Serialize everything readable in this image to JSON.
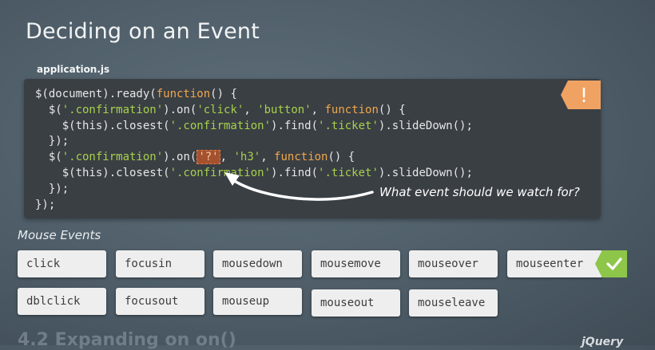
{
  "slide": {
    "title": "Deciding on an Event",
    "filename": "application.js",
    "alert_symbol": "!",
    "annotation": "What event should we watch for?"
  },
  "code": {
    "l1": {
      "a": "$(document).ready(",
      "b": "function",
      "c": "() {"
    },
    "l2": {
      "a": "  $(",
      "b": "'.confirmation'",
      "c": ").on(",
      "d": "'click'",
      "e": ", ",
      "f": "'button'",
      "g": ", ",
      "h": "function",
      "i": "() {"
    },
    "l3": {
      "a": "    $(this).closest(",
      "b": "'.confirmation'",
      "c": ").find(",
      "d": "'.ticket'",
      "e": ").slideDown();"
    },
    "l4": {
      "a": "  });"
    },
    "l5": {
      "a": "  $(",
      "b": "'.confirmation'",
      "c": ").on(",
      "d": "'?'",
      "e": ", ",
      "f": "'h3'",
      "g": ", ",
      "h": "function",
      "i": "() {"
    },
    "l6": {
      "a": "    $(this).closest(",
      "b": "'.confirmation'",
      "c": ").find(",
      "d": "'.ticket'",
      "e": ").slideDown();"
    },
    "l7": {
      "a": "  });"
    },
    "l8": {
      "a": "});"
    }
  },
  "mouse_events": {
    "label": "Mouse Events",
    "row1": [
      "click",
      "focusin",
      "mousedown",
      "mousemove",
      "mouseover",
      "mouseenter"
    ],
    "row2": [
      "dblclick",
      "focusout",
      "mouseup",
      "mouseout",
      "mouseleave"
    ],
    "correct": "mouseenter"
  },
  "footer": {
    "section": "4.2 Expanding on on()",
    "brand": "jQuery"
  },
  "colors": {
    "background": "#4e5d68",
    "code_bg": "#3a3f44",
    "string": "#a7d14a",
    "keyword": "#f2a64a",
    "alert": "#f0a263",
    "check": "#8ec64a"
  }
}
